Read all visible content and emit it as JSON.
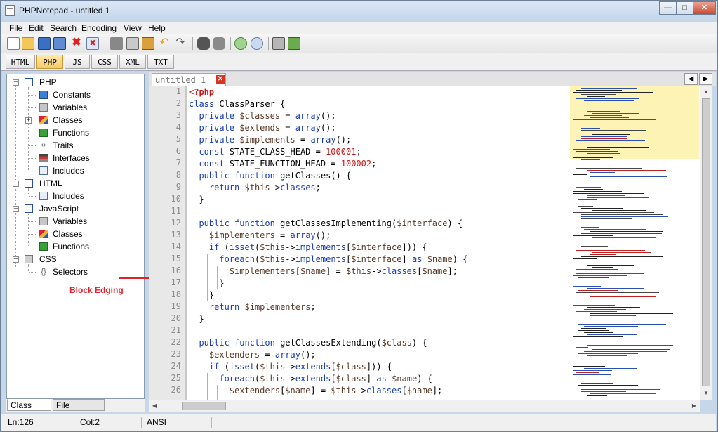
{
  "window": {
    "title": "PHPNotepad - untitled 1"
  },
  "menu": [
    "File",
    "Edit",
    "Search",
    "Encoding",
    "View",
    "Help"
  ],
  "toolbar_icons": [
    "new-file-icon",
    "open-folder-icon",
    "save-icon",
    "save-all-icon",
    "close-icon",
    "close-all-icon",
    "cut-icon",
    "copy-icon",
    "paste-icon",
    "undo-icon",
    "redo-icon",
    "find-icon",
    "replace-icon",
    "zoom-in-icon",
    "zoom-out-icon",
    "print-icon",
    "exit-icon"
  ],
  "language_tabs": [
    {
      "label": "HTML",
      "active": false
    },
    {
      "label": "PHP",
      "active": true
    },
    {
      "label": "JS",
      "active": false
    },
    {
      "label": "CSS",
      "active": false
    },
    {
      "label": "XML",
      "active": false
    },
    {
      "label": "TXT",
      "active": false
    }
  ],
  "tree": [
    {
      "label": "PHP",
      "level": 0,
      "icon": "php-file-icon"
    },
    {
      "label": "Constants",
      "level": 1,
      "icon": "blue-cube-icon"
    },
    {
      "label": "Variables",
      "level": 1,
      "icon": "grey-cube-icon"
    },
    {
      "label": "Classes",
      "level": 1,
      "icon": "classes-icon"
    },
    {
      "label": "Functions",
      "level": 1,
      "icon": "green-function-icon"
    },
    {
      "label": "Traits",
      "level": 1,
      "icon": "traits-icon"
    },
    {
      "label": "Interfaces",
      "level": 1,
      "icon": "interfaces-icon"
    },
    {
      "label": "Includes",
      "level": 1,
      "icon": "include-arrow-icon"
    },
    {
      "label": "HTML",
      "level": 0,
      "icon": "html-file-icon"
    },
    {
      "label": "Includes",
      "level": 1,
      "icon": "include-arrow-icon"
    },
    {
      "label": "JavaScript",
      "level": 0,
      "icon": "js-file-icon"
    },
    {
      "label": "Variables",
      "level": 1,
      "icon": "grey-cube-icon"
    },
    {
      "label": "Classes",
      "level": 1,
      "icon": "classes-icon"
    },
    {
      "label": "Functions",
      "level": 1,
      "icon": "green-function-icon"
    },
    {
      "label": "CSS",
      "level": 0,
      "icon": "css-file-icon"
    },
    {
      "label": "Selectors",
      "level": 1,
      "icon": "braces-icon"
    }
  ],
  "sidebar_tabs": [
    {
      "label": "Class View",
      "active": true
    },
    {
      "label": "File Explorer",
      "active": false
    }
  ],
  "document_tab": {
    "label": "untitled 1"
  },
  "code_lines": [
    "<?php",
    "class ClassParser {",
    "  private $classes = array();",
    "  private $extends = array();",
    "  private $implements = array();",
    "  const STATE_CLASS_HEAD = 100001;",
    "  const STATE_FUNCTION_HEAD = 100002;",
    "  public function getClasses() {",
    "    return $this->classes;",
    "  }",
    "",
    "  public function getClassesImplementing($interface) {",
    "    $implementers = array();",
    "    if (isset($this->implements[$interface])) {",
    "      foreach($this->implements[$interface] as $name) {",
    "        $implementers[$name] = $this->classes[$name];",
    "      }",
    "    }",
    "    return $implementers;",
    "  }",
    "",
    "  public function getClassesExtending($class) {",
    "    $extenders = array();",
    "    if (isset($this->extends[$class])) {",
    "      foreach($this->extends[$class] as $name) {",
    "        $extenders[$name] = $this->classes[$name];"
  ],
  "annotation": {
    "label": "Block Edging"
  },
  "status": {
    "line": "Ln:126",
    "col": "Col:2",
    "encoding": "ANSI"
  },
  "colors": {
    "keyword": "#1a3db5",
    "number": "#cd1414",
    "variable": "#5c3b2a",
    "active_tab": "#f7c96a",
    "annotation": "#e0222a",
    "minimap_viewport": "#fdf3b4"
  }
}
